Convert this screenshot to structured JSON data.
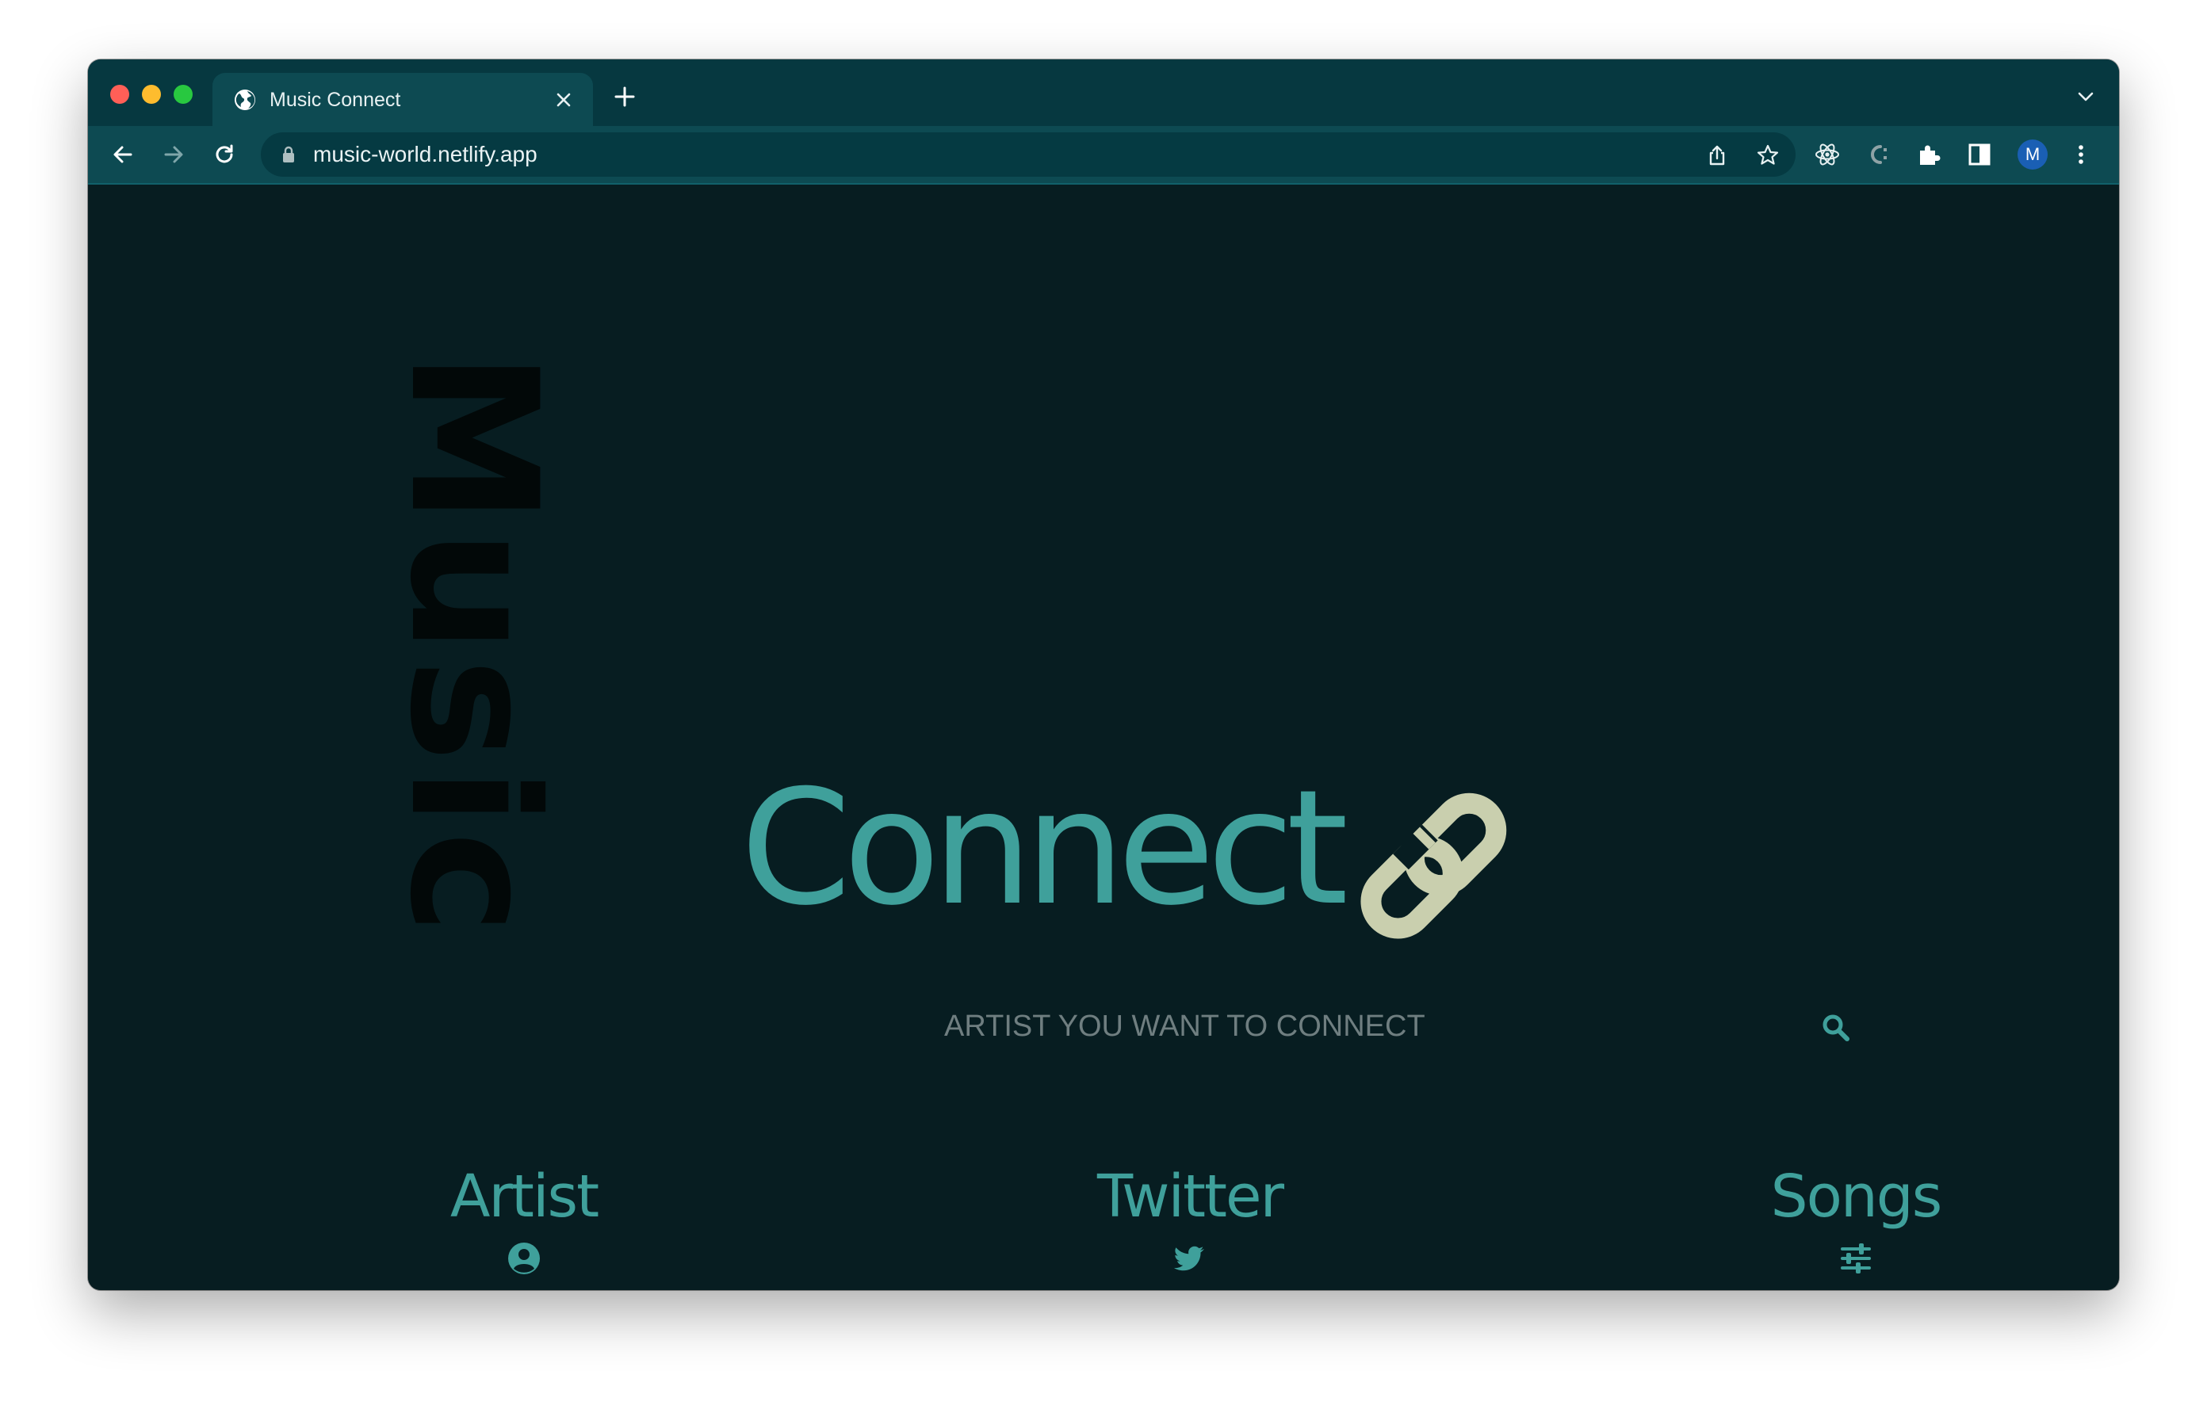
{
  "browser": {
    "tab": {
      "title": "Music Connect",
      "favicon": "globe-icon"
    },
    "url": "music-world.netlify.app",
    "profile_initial": "M",
    "toolbar_icons": [
      "share-icon",
      "star-icon",
      "react-devtools-icon",
      "colorzilla-icon",
      "extensions-icon",
      "side-panel-icon",
      "more-icon"
    ]
  },
  "page": {
    "hero_vertical": "Music",
    "hero_main": "Connect",
    "hero_icon": "link-icon",
    "search": {
      "placeholder": "ARTIST YOU WANT TO CONNECT",
      "icon": "search-icon"
    },
    "nav": [
      {
        "label": "Artist",
        "icon": "user-circle-icon"
      },
      {
        "label": "Twitter",
        "icon": "twitter-icon"
      },
      {
        "label": "Songs",
        "icon": "sliders-icon"
      }
    ]
  },
  "colors": {
    "window_bg": "#071d21",
    "titlebar": "#063840",
    "toolbar": "#0d4a52",
    "accent_teal": "#3fa09b",
    "link_icon": "#c9cfae",
    "music_text": "#020808"
  }
}
